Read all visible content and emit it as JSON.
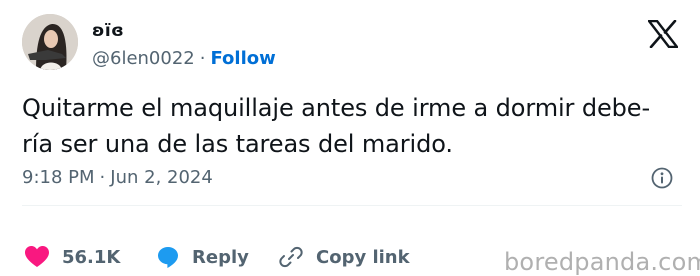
{
  "user": {
    "display_name": "ʚïɞ",
    "handle": "@6len0022",
    "separator": "·",
    "follow_label": "Follow"
  },
  "tweet": {
    "text": "Quitarme el maquillaje antes de irme a dormir debe-\nría ser una de  las tareas del marido.",
    "time": "9:18 PM",
    "date": "Jun 2, 2024"
  },
  "actions": {
    "likes": "56.1K",
    "reply_label": "Reply",
    "copy_link_label": "Copy link"
  },
  "watermark": "boredpanda.com",
  "colors": {
    "text": "#0f1419",
    "secondary": "#536471",
    "follow": "#006fd6",
    "heart": "#f91880",
    "reply_bubble": "#1d9bf0"
  }
}
